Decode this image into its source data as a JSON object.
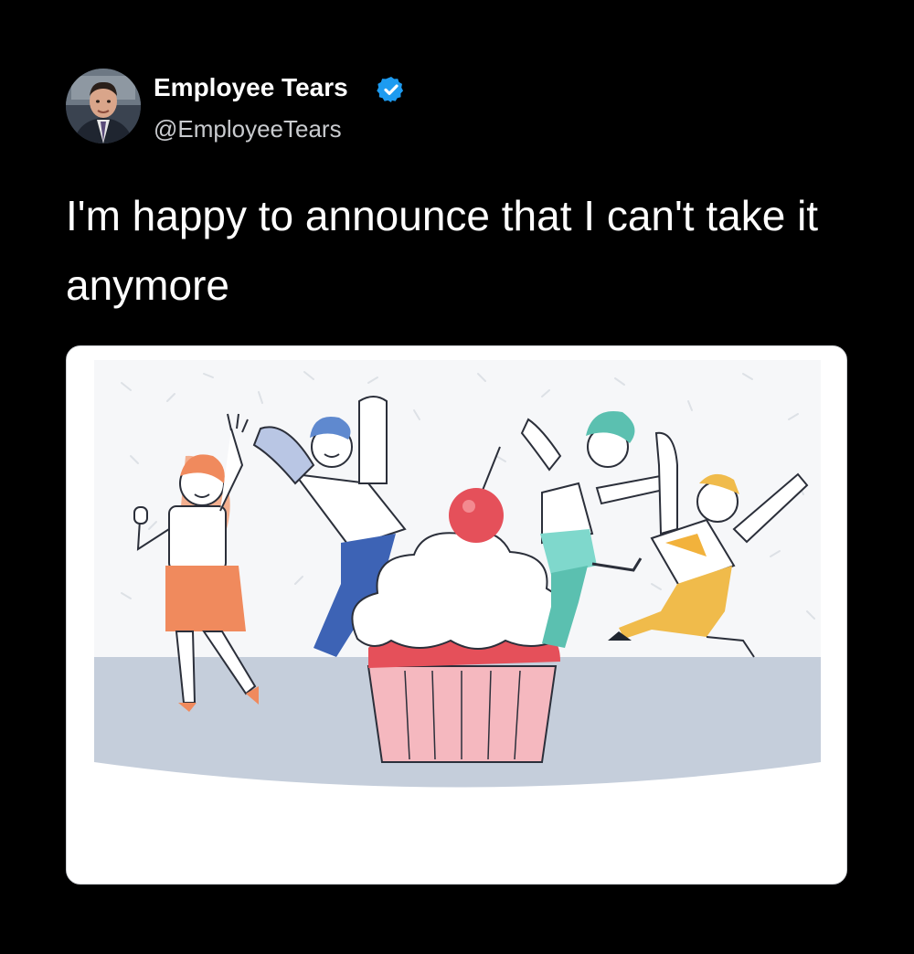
{
  "tweet": {
    "author": {
      "name": "Employee Tears",
      "handle": "@EmployeeTears",
      "verified": true,
      "avatar_icon": "profile-photo"
    },
    "text": "I'm happy to announce that I can't take it anymore",
    "media": {
      "type": "illustration",
      "icon": "celebration-cupcake-illustration"
    }
  },
  "colors": {
    "background": "#000000",
    "text_primary": "#ffffff",
    "text_secondary": "#c9cbcf",
    "verified_blue": "#1d9bf0"
  }
}
